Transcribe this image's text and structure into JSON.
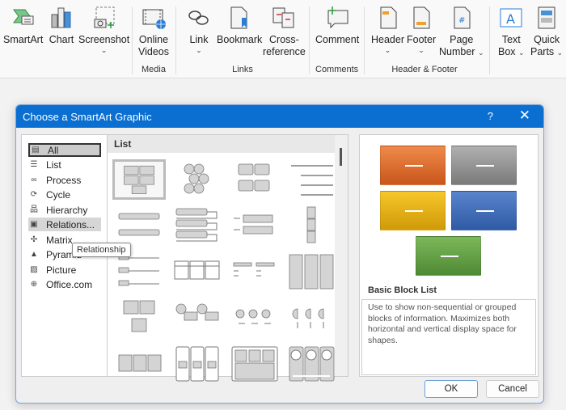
{
  "ribbon": {
    "buttons": [
      {
        "label": "SmartArt",
        "icon": "smartart-icon"
      },
      {
        "label": "Chart",
        "icon": "chart-icon"
      },
      {
        "label": "Screenshot",
        "icon": "screenshot-icon",
        "dropdown": true
      },
      {
        "label": "Online\nVideos",
        "label1": "Online",
        "label2": "Videos",
        "icon": "online-video-icon"
      },
      {
        "label": "Link",
        "icon": "link-icon",
        "dropdown": true
      },
      {
        "label": "Bookmark",
        "icon": "bookmark-icon"
      },
      {
        "label1": "Cross-",
        "label2": "reference",
        "icon": "cross-reference-icon"
      },
      {
        "label": "Comment",
        "icon": "comment-icon"
      },
      {
        "label": "Header",
        "icon": "header-icon",
        "dropdown": true
      },
      {
        "label": "Footer",
        "icon": "footer-icon",
        "dropdown": true
      },
      {
        "label1": "Page",
        "label2": "Number",
        "icon": "page-number-icon",
        "dropdown": true
      },
      {
        "label1": "Text",
        "label2": "Box",
        "icon": "text-box-icon",
        "dropdown": true
      },
      {
        "label1": "Quick",
        "label2": "Parts",
        "icon": "quick-parts-icon",
        "dropdown": true
      }
    ],
    "groups": [
      "Media",
      "Links",
      "Comments",
      "Header & Footer"
    ],
    "chevron": "⌄"
  },
  "dialog": {
    "title": "Choose a SmartArt Graphic",
    "help": "?",
    "close": "✕",
    "categories": [
      {
        "label": "All",
        "selected": true
      },
      {
        "label": "List"
      },
      {
        "label": "Process"
      },
      {
        "label": "Cycle"
      },
      {
        "label": "Hierarchy"
      },
      {
        "label": "Relations...",
        "hovered": true
      },
      {
        "label": "Matrix"
      },
      {
        "label": "Pyramid"
      },
      {
        "label": "Picture"
      },
      {
        "label": "Office.com"
      }
    ],
    "tooltip": "Relationship",
    "gallery_header": "List",
    "layouts_count": 20,
    "selected_layout_index": 0,
    "preview": {
      "name": "Basic Block List",
      "description": "Use to show non-sequential or grouped blocks of information. Maximizes both horizontal and vertical display space for shapes.",
      "colors": [
        "#e07030",
        "#8e8e8e",
        "#e8b018",
        "#3d67b8",
        "#62a045"
      ]
    },
    "ok_label": "OK",
    "cancel_label": "Cancel"
  }
}
